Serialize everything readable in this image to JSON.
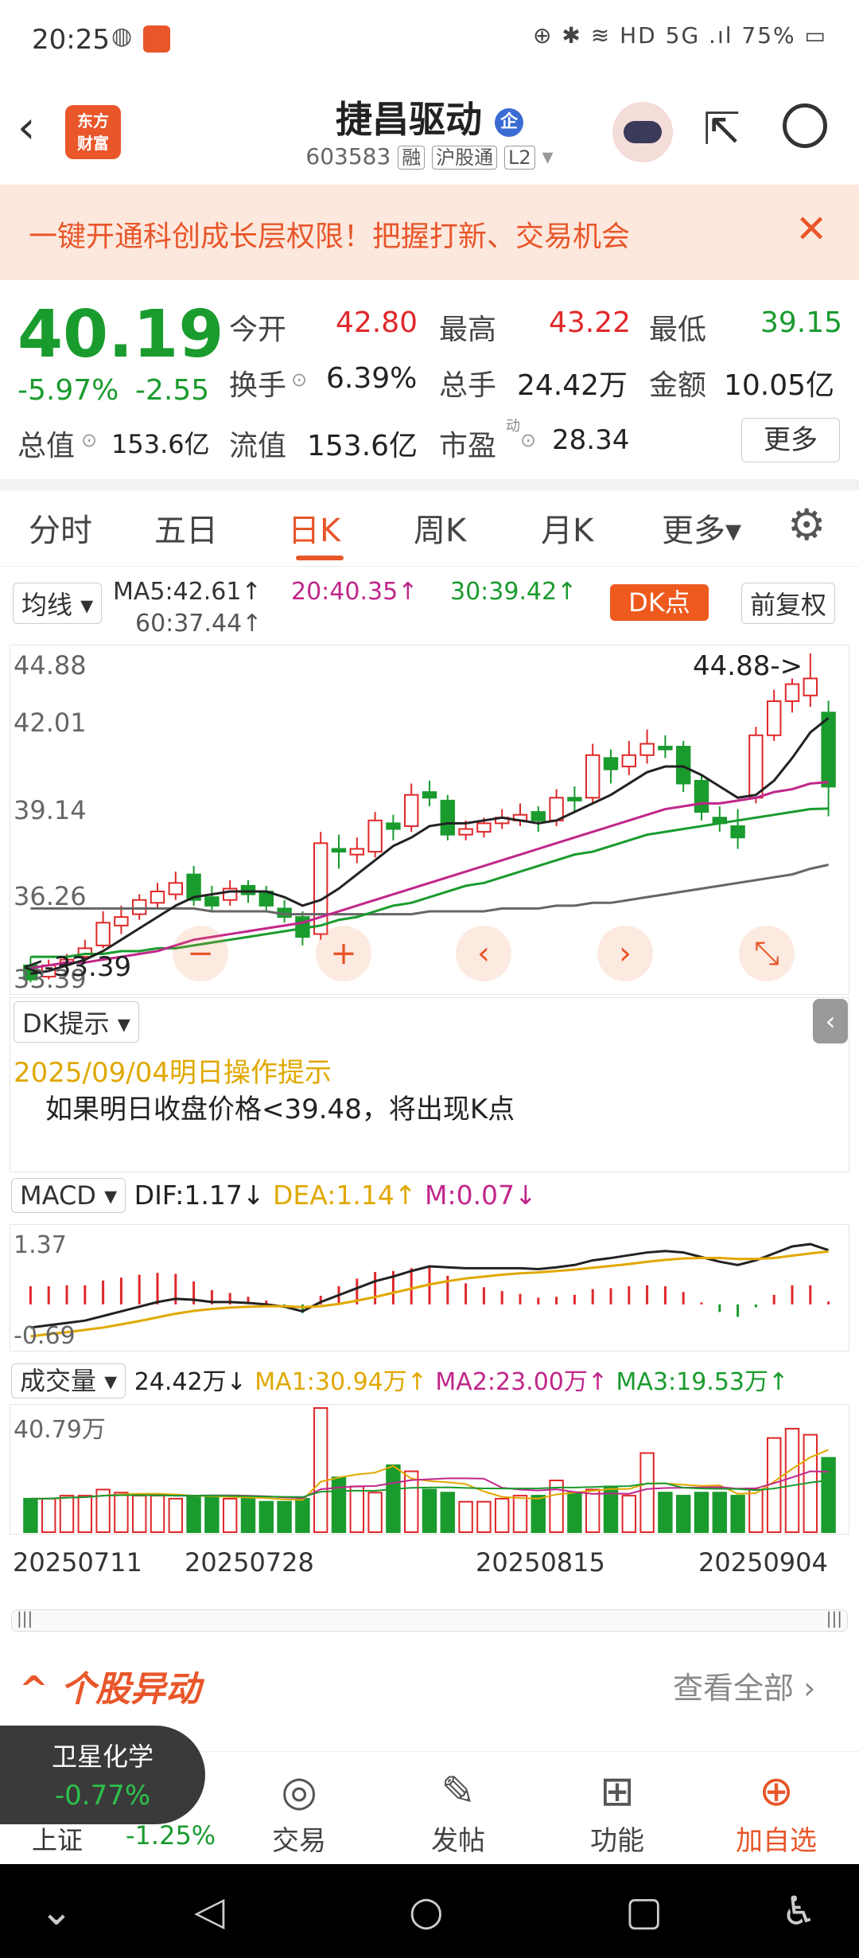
{
  "status_bar": {
    "time": "20:25",
    "system": "⊕ ✱ ≋ HD 5G .ıl 75% ▭"
  },
  "header": {
    "logo_line1": "东方",
    "logo_line2": "财富",
    "title": "捷昌驱动",
    "badge": "企",
    "code": "603583",
    "tag1": "融",
    "tag2": "沪股通",
    "tag3": "L2"
  },
  "banner": {
    "text": "一键开通科创成长层权限！把握打新、交易机会"
  },
  "quote": {
    "price": "40.19",
    "change_pct": "-5.97%",
    "change_amt": "-2.55",
    "open_label": "今开",
    "open": "42.80",
    "high_label": "最高",
    "high": "43.22",
    "low_label": "最低",
    "low": "39.15",
    "turnover_label": "换手",
    "turnover": "6.39%",
    "volume_label": "总手",
    "volume": "24.42万",
    "amount_label": "金额",
    "amount": "10.05亿",
    "mktcap_label": "总值",
    "mktcap": "153.6亿",
    "float_label": "流值",
    "float": "153.6亿",
    "pe_label": "市盈",
    "pe_sup": "动",
    "pe": "28.34",
    "more": "更多"
  },
  "tabs": [
    "分时",
    "五日",
    "日K",
    "周K",
    "月K",
    "更多▾"
  ],
  "ma_row": {
    "selector": "均线 ▾",
    "ma5": "MA5:42.61↑",
    "ma20": "20:40.35↑",
    "ma30": "30:39.42↑",
    "ma60": "60:37.44↑",
    "dk": "DK点",
    "fq": "前复权"
  },
  "kchart": {
    "y_labels": [
      "44.88",
      "42.01",
      "39.14",
      "36.26",
      "33.39"
    ],
    "max_marker": "44.88->",
    "min_marker": "<-33.39"
  },
  "dk_panel": {
    "selector": "DK提示 ▾",
    "date_line": "2025/09/04明日操作提示",
    "message": "如果明日收盘价格<39.48，将出现K点"
  },
  "macd": {
    "selector": "MACD ▾",
    "dif": "DIF:1.17↓",
    "dea": "DEA:1.14↑",
    "m": "M:0.07↓",
    "y_top": "1.37",
    "y_bottom": "-0.69"
  },
  "volume": {
    "selector": "成交量 ▾",
    "vol": "24.42万↓",
    "ma1": "MA1:30.94万↑",
    "ma2": "MA2:23.00万↑",
    "ma3": "MA3:19.53万↑",
    "y_top": "40.79万"
  },
  "dates": [
    "20250711",
    "20250728",
    "20250815",
    "20250904"
  ],
  "anomaly": {
    "title": "个股异动",
    "view_all": "查看全部 ›"
  },
  "bottom_nav": {
    "index_name": "上证",
    "index_chg": "-1.25%",
    "items": [
      "交易",
      "发帖",
      "功能",
      "加自选"
    ]
  },
  "float_pill": {
    "name": "卫星化学",
    "chg": "-0.77%"
  },
  "colors": {
    "accent": "#e8562a",
    "up": "#e0282a",
    "down": "#1a9b2e"
  },
  "chart_data": {
    "type": "candlestick",
    "candles": [
      [
        33.9,
        33.4,
        34.2,
        33.3
      ],
      [
        33.5,
        33.9,
        34.1,
        33.4
      ],
      [
        34.0,
        34.1,
        34.3,
        33.8
      ],
      [
        34.2,
        34.5,
        34.8,
        34.0
      ],
      [
        34.6,
        35.4,
        35.8,
        34.5
      ],
      [
        35.3,
        35.6,
        36.0,
        35.0
      ],
      [
        35.7,
        36.2,
        36.4,
        35.5
      ],
      [
        36.1,
        36.5,
        36.8,
        35.9
      ],
      [
        36.4,
        36.8,
        37.2,
        36.2
      ],
      [
        37.1,
        36.2,
        37.4,
        36.0
      ],
      [
        36.3,
        36.0,
        36.7,
        35.8
      ],
      [
        36.2,
        36.6,
        36.9,
        36.0
      ],
      [
        36.7,
        36.4,
        36.9,
        36.1
      ],
      [
        36.5,
        36.0,
        36.7,
        35.8
      ],
      [
        35.9,
        35.6,
        36.2,
        35.4
      ],
      [
        35.6,
        34.9,
        35.8,
        34.6
      ],
      [
        35.0,
        38.2,
        38.6,
        34.8
      ],
      [
        38.0,
        37.9,
        38.5,
        37.3
      ],
      [
        37.8,
        38.0,
        38.4,
        37.5
      ],
      [
        37.9,
        39.0,
        39.3,
        37.7
      ],
      [
        38.9,
        38.7,
        39.2,
        38.3
      ],
      [
        38.8,
        39.9,
        40.3,
        38.6
      ],
      [
        40.0,
        39.8,
        40.4,
        39.5
      ],
      [
        39.7,
        38.5,
        39.9,
        38.3
      ],
      [
        38.5,
        38.7,
        39.0,
        38.3
      ],
      [
        38.6,
        38.9,
        39.1,
        38.4
      ],
      [
        38.9,
        39.1,
        39.4,
        38.7
      ],
      [
        39.0,
        39.2,
        39.6,
        38.8
      ],
      [
        39.3,
        39.0,
        39.5,
        38.6
      ],
      [
        39.0,
        39.8,
        40.1,
        38.8
      ],
      [
        39.8,
        39.7,
        40.2,
        39.3
      ],
      [
        39.8,
        41.3,
        41.7,
        39.6
      ],
      [
        41.2,
        40.8,
        41.5,
        40.3
      ],
      [
        40.9,
        41.3,
        41.8,
        40.6
      ],
      [
        41.3,
        41.7,
        42.2,
        41.0
      ],
      [
        41.6,
        41.5,
        42.0,
        41.2
      ],
      [
        41.6,
        40.3,
        41.8,
        40.0
      ],
      [
        40.4,
        39.3,
        40.6,
        39.0
      ],
      [
        39.1,
        38.9,
        39.5,
        38.6
      ],
      [
        38.8,
        38.4,
        39.4,
        38.0
      ],
      [
        39.8,
        42.0,
        42.3,
        39.6
      ],
      [
        42.0,
        43.2,
        43.6,
        41.8
      ],
      [
        43.2,
        43.8,
        44.0,
        42.8
      ],
      [
        43.4,
        44.0,
        44.88,
        43.0
      ],
      [
        42.8,
        40.19,
        43.22,
        39.15
      ]
    ],
    "ma5": [
      33.6,
      33.7,
      33.9,
      34.1,
      34.4,
      34.8,
      35.2,
      35.6,
      36.0,
      36.3,
      36.4,
      36.5,
      36.5,
      36.5,
      36.3,
      36.0,
      36.2,
      36.6,
      37.1,
      37.6,
      38.1,
      38.4,
      38.8,
      38.9,
      38.9,
      39.0,
      39.1,
      39.0,
      38.9,
      39.0,
      39.3,
      39.6,
      39.9,
      40.3,
      40.7,
      40.9,
      40.9,
      40.6,
      40.2,
      39.8,
      39.9,
      40.4,
      41.2,
      42.1,
      42.61
    ],
    "ma20": [
      33.8,
      33.9,
      34.0,
      34.0,
      34.1,
      34.2,
      34.3,
      34.4,
      34.6,
      34.8,
      34.9,
      35.0,
      35.1,
      35.2,
      35.3,
      35.4,
      35.6,
      35.8,
      36.0,
      36.2,
      36.4,
      36.6,
      36.8,
      37.0,
      37.2,
      37.4,
      37.6,
      37.8,
      38.0,
      38.2,
      38.4,
      38.6,
      38.8,
      39.0,
      39.2,
      39.4,
      39.5,
      39.6,
      39.6,
      39.7,
      39.8,
      40.0,
      40.1,
      40.3,
      40.35
    ],
    "ma30": [
      34.2,
      34.2,
      34.2,
      34.3,
      34.3,
      34.4,
      34.4,
      34.5,
      34.5,
      34.6,
      34.7,
      34.8,
      34.9,
      35.0,
      35.1,
      35.2,
      35.3,
      35.5,
      35.6,
      35.8,
      36.0,
      36.1,
      36.3,
      36.5,
      36.7,
      36.8,
      37.0,
      37.2,
      37.4,
      37.6,
      37.8,
      37.9,
      38.1,
      38.3,
      38.5,
      38.6,
      38.7,
      38.8,
      38.9,
      39.0,
      39.1,
      39.2,
      39.3,
      39.4,
      39.42
    ],
    "ma60": [
      35.9,
      35.9,
      35.9,
      35.9,
      35.9,
      35.9,
      35.9,
      35.9,
      35.9,
      35.9,
      35.8,
      35.8,
      35.8,
      35.8,
      35.7,
      35.7,
      35.7,
      35.7,
      35.7,
      35.7,
      35.7,
      35.7,
      35.8,
      35.8,
      35.8,
      35.8,
      35.9,
      35.9,
      35.9,
      36.0,
      36.0,
      36.1,
      36.1,
      36.2,
      36.3,
      36.4,
      36.5,
      36.6,
      36.7,
      36.8,
      36.9,
      37.0,
      37.1,
      37.3,
      37.44
    ],
    "macd_dif": [
      -0.5,
      -0.45,
      -0.4,
      -0.35,
      -0.25,
      -0.15,
      -0.05,
      0.05,
      0.12,
      0.1,
      0.05,
      0.05,
      0.03,
      0.0,
      -0.05,
      -0.15,
      0.05,
      0.2,
      0.35,
      0.5,
      0.6,
      0.72,
      0.82,
      0.8,
      0.78,
      0.78,
      0.78,
      0.78,
      0.76,
      0.8,
      0.85,
      0.95,
      1.0,
      1.06,
      1.12,
      1.15,
      1.12,
      1.02,
      0.92,
      0.85,
      0.95,
      1.1,
      1.25,
      1.3,
      1.17
    ],
    "macd_dea": [
      -0.69,
      -0.64,
      -0.6,
      -0.55,
      -0.5,
      -0.43,
      -0.36,
      -0.28,
      -0.2,
      -0.14,
      -0.1,
      -0.07,
      -0.05,
      -0.04,
      -0.04,
      -0.06,
      -0.04,
      0.01,
      0.08,
      0.16,
      0.25,
      0.34,
      0.43,
      0.5,
      0.56,
      0.6,
      0.64,
      0.67,
      0.69,
      0.72,
      0.75,
      0.79,
      0.83,
      0.87,
      0.92,
      0.96,
      0.99,
      1.0,
      1.0,
      0.98,
      0.98,
      1.0,
      1.05,
      1.1,
      1.14
    ],
    "volume_wan": [
      11,
      11,
      12,
      12,
      14,
      13,
      12,
      12,
      11,
      12,
      12,
      11,
      11,
      10,
      10,
      11,
      40.79,
      18,
      15,
      13,
      22,
      20,
      14,
      13,
      10,
      10,
      11,
      12,
      12,
      17,
      13,
      14,
      15,
      12,
      26,
      13,
      12,
      13,
      13,
      12,
      14,
      30.94,
      34,
      32,
      24.42
    ],
    "y_range": [
      33.39,
      44.88
    ]
  }
}
